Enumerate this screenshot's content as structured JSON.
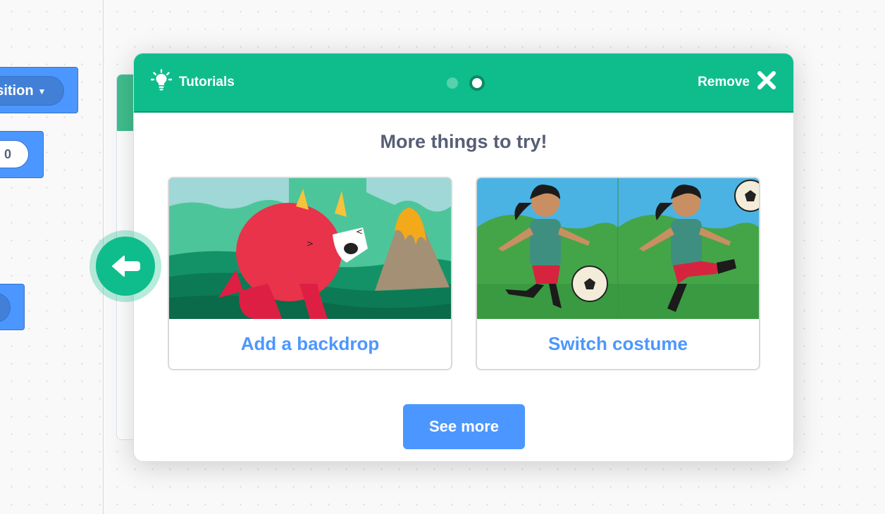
{
  "workspace": {
    "block1_dropdown_text": "osition",
    "block2_value": "0"
  },
  "tutorial": {
    "header": {
      "tutorials_label": "Tutorials",
      "remove_label": "Remove",
      "step_count": 2,
      "active_step": 2
    },
    "title": "More things to try!",
    "tiles": [
      {
        "label": "Add a backdrop"
      },
      {
        "label": "Switch costume"
      }
    ],
    "see_more_label": "See more"
  },
  "colors": {
    "header_green": "#0fbd8c",
    "link_blue": "#4c97ff",
    "title_gray": "#575e75"
  },
  "icons": {
    "tutorials": "lightbulb-icon",
    "remove": "close-icon",
    "back": "back-arrow-icon"
  }
}
